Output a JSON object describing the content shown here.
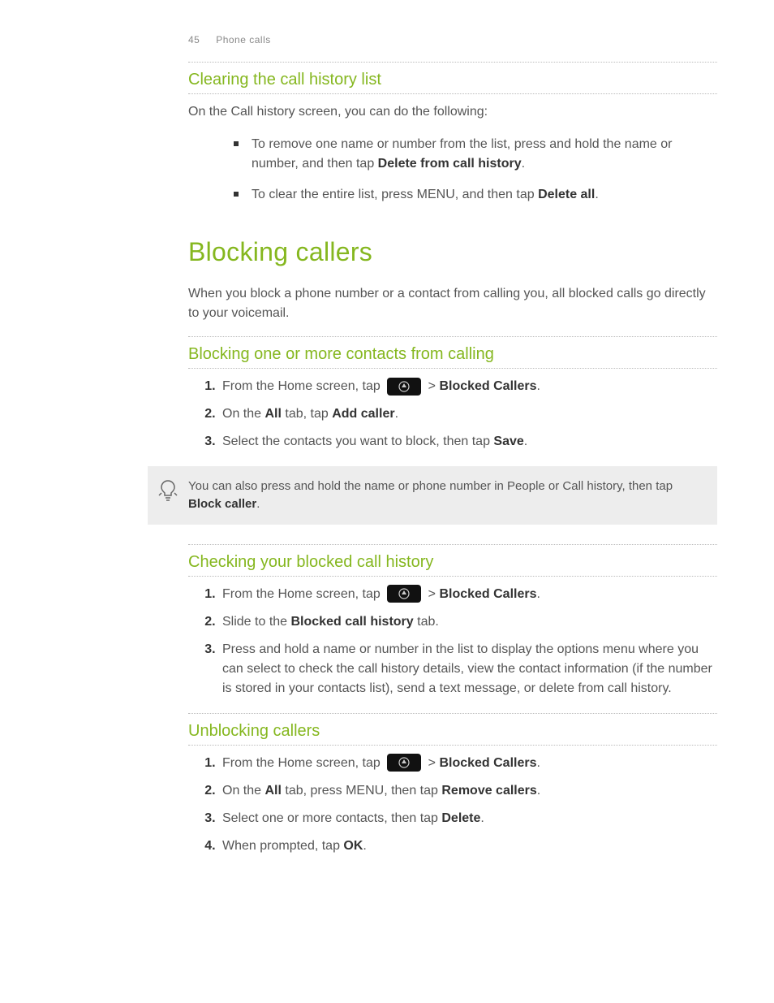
{
  "header": {
    "page_number": "45",
    "section_title": "Phone calls"
  },
  "section_clearing": {
    "title": "Clearing the call history list",
    "intro": "On the Call history screen, you can do the following:",
    "items": [
      {
        "pre": "To remove one name or number from the list, press and hold the name or number, and then tap ",
        "bold": "Delete from call history",
        "post": "."
      },
      {
        "pre": "To clear the entire list, press MENU, and then tap ",
        "bold": "Delete all",
        "post": "."
      }
    ]
  },
  "main_heading": "Blocking callers",
  "main_intro": "When you block a phone number or a contact from calling you, all blocked calls go directly to your voicemail.",
  "section_blocking": {
    "title": "Blocking one or more contacts from calling",
    "steps": [
      {
        "pre": "From the Home screen, tap ",
        "icon": true,
        "mid": "  > ",
        "bold": "Blocked Callers",
        "post": "."
      },
      {
        "pre": "On the ",
        "bold1": "All",
        "mid": " tab, tap ",
        "bold2": "Add caller",
        "post": "."
      },
      {
        "pre": "Select the contacts you want to block, then tap ",
        "bold": "Save",
        "post": "."
      }
    ]
  },
  "tip": {
    "pre": "You can also press and hold the name or phone number in People or Call history, then tap ",
    "bold": "Block caller",
    "post": "."
  },
  "section_checking": {
    "title": "Checking your blocked call history",
    "steps": [
      {
        "pre": "From the Home screen, tap ",
        "icon": true,
        "mid": "  > ",
        "bold": "Blocked Callers",
        "post": "."
      },
      {
        "pre": "Slide to the ",
        "bold": "Blocked call history",
        "post": " tab."
      },
      {
        "text": "Press and hold a name or number in the list to display the options menu where you can select to check the call history details, view the contact information (if the number is stored in your contacts list), send a text message, or delete from call history."
      }
    ]
  },
  "section_unblocking": {
    "title": "Unblocking callers",
    "steps": [
      {
        "pre": "From the Home screen, tap ",
        "icon": true,
        "mid": "  > ",
        "bold": "Blocked Callers",
        "post": "."
      },
      {
        "pre": "On the ",
        "bold1": "All",
        "mid": " tab, press MENU, then tap ",
        "bold2": "Remove callers",
        "post": "."
      },
      {
        "pre": "Select one or more contacts, then tap ",
        "bold": "Delete",
        "post": "."
      },
      {
        "pre": "When prompted, tap ",
        "bold": "OK",
        "post": "."
      }
    ]
  }
}
